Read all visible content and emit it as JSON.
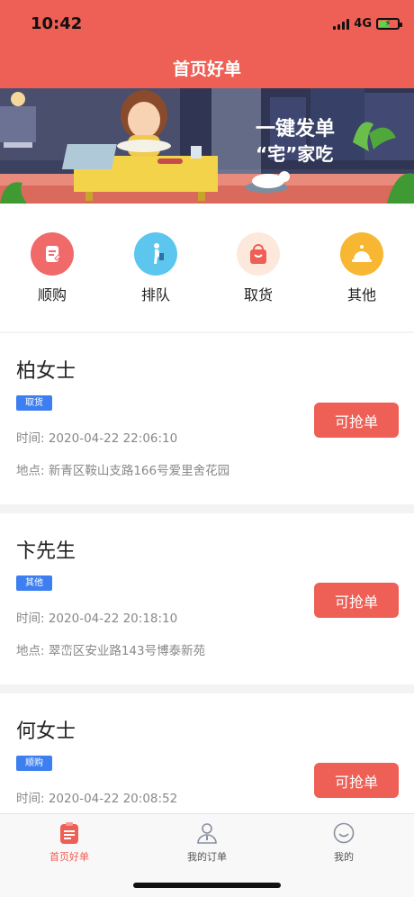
{
  "status_bar": {
    "time": "10:42",
    "network": "4G"
  },
  "header": {
    "title": "首页好单"
  },
  "banner": {
    "line1": "一键发单",
    "line2": "“宅”家吃"
  },
  "categories": [
    {
      "label": "顺购",
      "icon": "edit-note-icon",
      "color": "#f06a6a"
    },
    {
      "label": "排队",
      "icon": "person-walking-icon",
      "color": "#5cc6ee"
    },
    {
      "label": "取货",
      "icon": "shopping-bag-icon",
      "color": "#ee5f55"
    },
    {
      "label": "其他",
      "icon": "service-bell-icon",
      "color": "#f7b733"
    }
  ],
  "orders": [
    {
      "name": "柏女士",
      "tag": "取货",
      "time": "时间: 2020-04-22 22:06:10",
      "address": "地点: 新青区鞍山支路166号爱里舍花园",
      "action": "可抢单"
    },
    {
      "name": "卞先生",
      "tag": "其他",
      "time": "时间: 2020-04-22 20:18:10",
      "address": "地点: 翠峦区安业路143号博泰新苑",
      "action": "可抢单"
    },
    {
      "name": "何女士",
      "tag": "顺购",
      "time": "时间: 2020-04-22 20:08:52",
      "address": "",
      "action": "可抢单"
    }
  ],
  "tabbar": {
    "active_color": "#ee5f55",
    "items": [
      {
        "label": "首页好单",
        "icon": "clipboard-list-icon"
      },
      {
        "label": "我的订单",
        "icon": "user-icon"
      },
      {
        "label": "我的",
        "icon": "smiley-face-icon"
      }
    ]
  }
}
